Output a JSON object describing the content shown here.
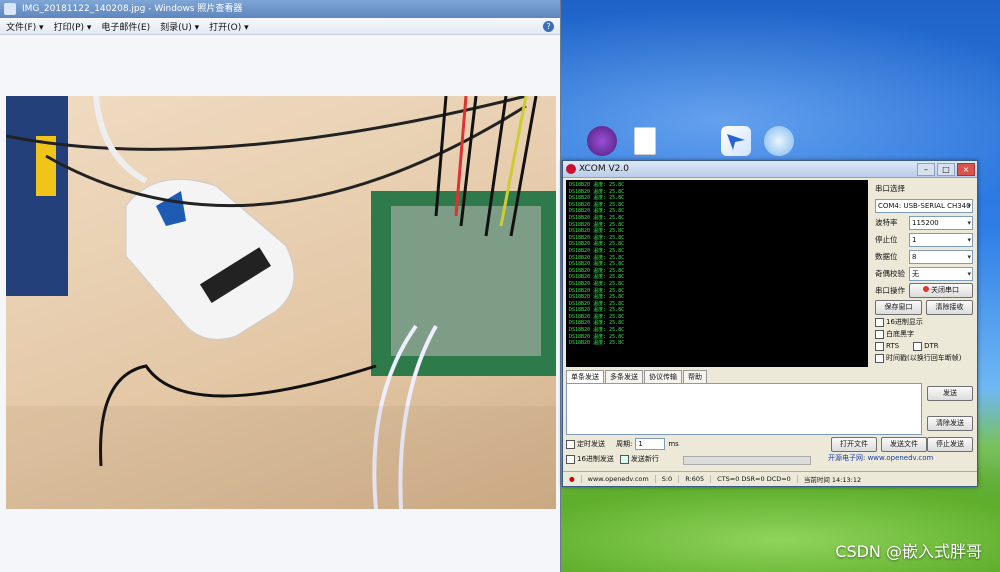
{
  "viewer": {
    "title": "IMG_20181122_140208.jpg - Windows 照片查看器",
    "menu": [
      "文件(F) ▾",
      "打印(P) ▾",
      "电子邮件(E)",
      "刻录(U) ▾",
      "打开(O) ▾"
    ],
    "help": "?"
  },
  "desktop": {
    "icons": [
      "app-icon",
      "document-icon",
      "feishu-icon",
      "cloud-icon"
    ],
    "watermark": "CSDN @嵌入式胖哥"
  },
  "xcom": {
    "title": "XCOM V2.0",
    "terminal_lines": [
      "DS18B20 温度: 25.8C",
      "DS18B20 温度: 25.8C",
      "DS18B20 温度: 25.8C",
      "DS18B20 温度: 25.8C",
      "DS18B20 温度: 25.8C",
      "DS18B20 温度: 25.8C",
      "DS18B20 温度: 25.8C",
      "DS18B20 温度: 25.8C",
      "DS18B20 温度: 25.8C",
      "DS18B20 温度: 25.8C",
      "DS18B20 温度: 25.8C",
      "DS18B20 温度: 25.8C",
      "DS18B20 温度: 25.8C",
      "DS18B20 温度: 25.8C",
      "DS18B20 温度: 25.8C",
      "DS18B20 温度: 25.8C",
      "DS18B20 温度: 25.8C",
      "DS18B20 温度: 25.8C",
      "DS18B20 温度: 25.8C",
      "DS18B20 温度: 25.8C",
      "DS18B20 温度: 25.8C",
      "DS18B20 温度: 25.8C",
      "DS18B20 温度: 25.8C",
      "DS18B20 温度: 25.8C",
      "DS18B20 温度: 25.8C"
    ],
    "port_label": "串口选择",
    "port_value": "COM4: USB-SERIAL CH340",
    "baud_label": "波特率",
    "baud_value": "115200",
    "stop_label": "停止位",
    "stop_value": "1",
    "data_label": "数据位",
    "data_value": "8",
    "parity_label": "奇偶校验",
    "parity_value": "无",
    "op_label": "串口操作",
    "op_button": "关闭串口",
    "save_button": "保存窗口",
    "clear_button": "清除接收",
    "checks": [
      "16进制显示",
      "白底黑字",
      "RTS",
      "DTR",
      "时间戳(以换行回车断帧)"
    ],
    "tabs": [
      "单条发送",
      "多条发送",
      "协议传输",
      "帮助"
    ],
    "send_button": "发送",
    "clear_send_button": "清除发送",
    "timer_label": "定时发送",
    "period_label": "周期:",
    "period_value": "1",
    "period_unit": "ms",
    "hex_send_label": "16进制发送",
    "newline_label": "发送新行",
    "open_file_button": "打开文件",
    "send_file_button": "发送文件",
    "stop_send_button": "停止发送",
    "website": "开源电子网: www.openedv.com",
    "status": [
      "www.openedv.com",
      "S:0",
      "R:605",
      "CTS=0 DSR=0 DCD=0",
      "当前时间 14:13:12"
    ]
  }
}
